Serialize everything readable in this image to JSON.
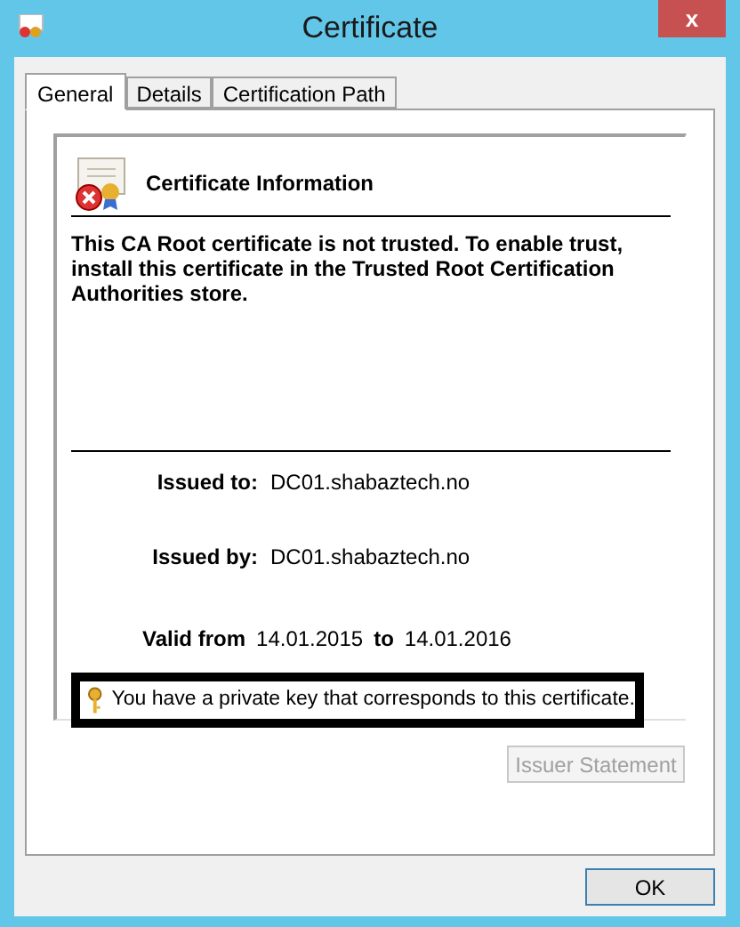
{
  "window": {
    "title": "Certificate",
    "close": "x"
  },
  "tabs": [
    {
      "label": "General",
      "selected": true
    },
    {
      "label": "Details",
      "selected": false
    },
    {
      "label": "Certification Path",
      "selected": false
    }
  ],
  "info": {
    "heading": "Certificate Information",
    "message": "This CA Root certificate is not trusted. To enable trust, install this certificate in the Trusted Root Certification Authorities store.",
    "issued_to": {
      "label": "Issued to:",
      "value": "DC01.shabaztech.no"
    },
    "issued_by": {
      "label": "Issued by:",
      "value": "DC01.shabaztech.no"
    },
    "valid": {
      "from_label": "Valid from",
      "from": "14.01.2015",
      "to_label": "to",
      "to": "14.01.2016"
    },
    "private_key": {
      "text": "You have a private key that corresponds to this certificate.",
      "highlighted": true
    }
  },
  "buttons": [
    {
      "label": "Issuer Statement",
      "disabled": true
    },
    {
      "label": "OK",
      "disabled": false
    }
  ]
}
